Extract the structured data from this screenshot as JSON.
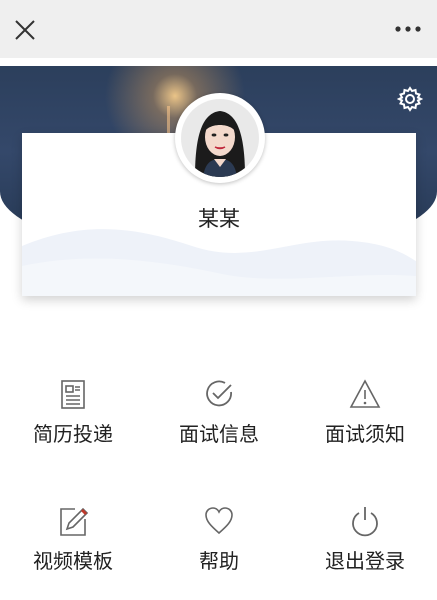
{
  "profile": {
    "name": "某某"
  },
  "menu": [
    {
      "label": "简历投递",
      "icon": "resume-icon"
    },
    {
      "label": "面试信息",
      "icon": "check-circle-icon"
    },
    {
      "label": "面试须知",
      "icon": "warning-icon"
    },
    {
      "label": "视频模板",
      "icon": "edit-note-icon"
    },
    {
      "label": "帮助",
      "icon": "heart-icon"
    },
    {
      "label": "退出登录",
      "icon": "power-icon"
    }
  ],
  "colors": {
    "icon": "#666666",
    "text": "#222222",
    "topbar": "#efefef",
    "hero": "#2c3f5c"
  }
}
